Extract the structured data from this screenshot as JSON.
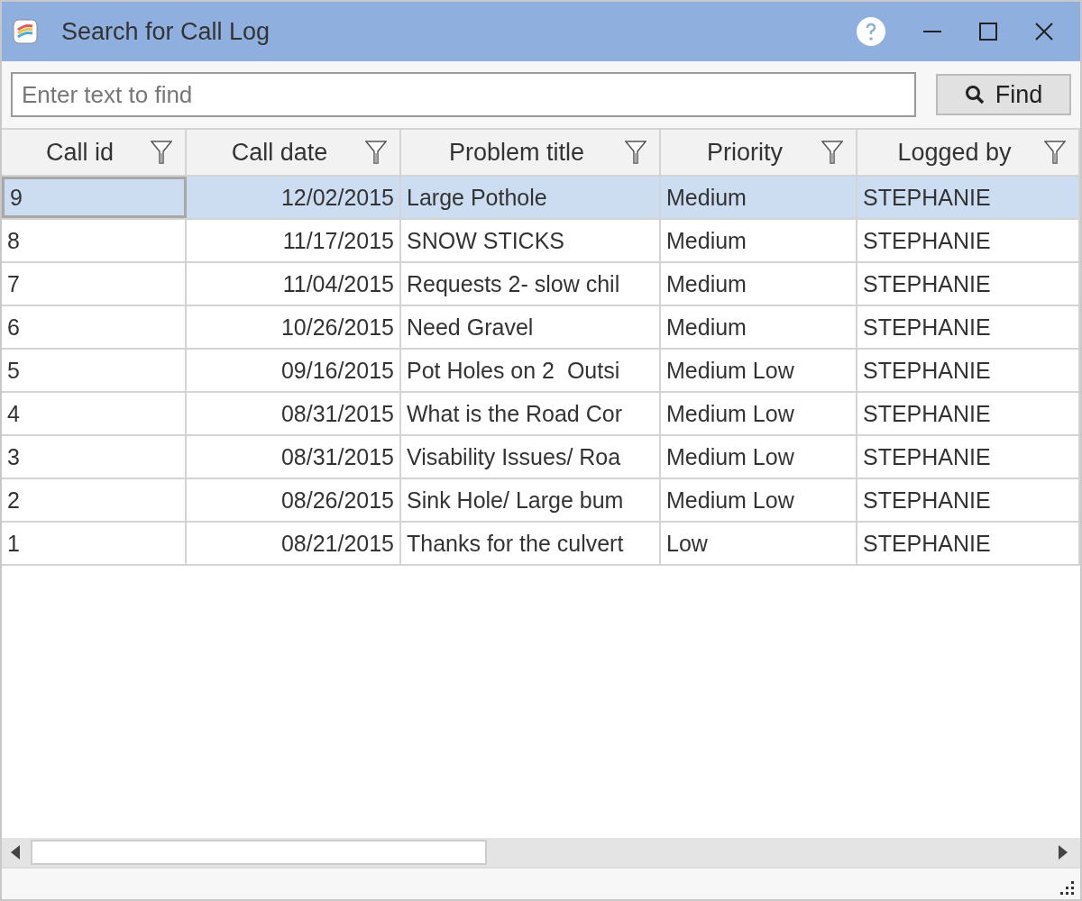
{
  "window": {
    "title": "Search for Call Log"
  },
  "search": {
    "placeholder": "Enter text to find",
    "button": "Find"
  },
  "table": {
    "columns": [
      {
        "label": "Call id",
        "kind": "text"
      },
      {
        "label": "Call date",
        "kind": "date"
      },
      {
        "label": "Problem title",
        "kind": "text"
      },
      {
        "label": "Priority",
        "kind": "text"
      },
      {
        "label": "Logged by",
        "kind": "text"
      }
    ],
    "rows": [
      {
        "cells": [
          "9",
          "12/02/2015",
          "Large Pothole",
          "Medium",
          "STEPHANIE"
        ],
        "selected": true
      },
      {
        "cells": [
          "8",
          "11/17/2015",
          "SNOW STICKS",
          "Medium",
          "STEPHANIE"
        ],
        "selected": false
      },
      {
        "cells": [
          "7",
          "11/04/2015",
          "Requests 2- slow chil",
          "Medium",
          "STEPHANIE"
        ],
        "selected": false
      },
      {
        "cells": [
          "6",
          "10/26/2015",
          "Need Gravel",
          "Medium",
          "STEPHANIE"
        ],
        "selected": false
      },
      {
        "cells": [
          "5",
          "09/16/2015",
          "Pot Holes on 2  Outsi",
          "Medium Low",
          "STEPHANIE"
        ],
        "selected": false
      },
      {
        "cells": [
          "4",
          "08/31/2015",
          "What is the Road Cor",
          "Medium Low",
          "STEPHANIE"
        ],
        "selected": false
      },
      {
        "cells": [
          "3",
          "08/31/2015",
          "Visability Issues/ Roa",
          "Medium Low",
          "STEPHANIE"
        ],
        "selected": false
      },
      {
        "cells": [
          "2",
          "08/26/2015",
          "Sink Hole/ Large bum",
          "Medium Low",
          "STEPHANIE"
        ],
        "selected": false
      },
      {
        "cells": [
          "1",
          "08/21/2015",
          "Thanks for the culvert",
          "Low",
          "STEPHANIE"
        ],
        "selected": false
      }
    ]
  }
}
